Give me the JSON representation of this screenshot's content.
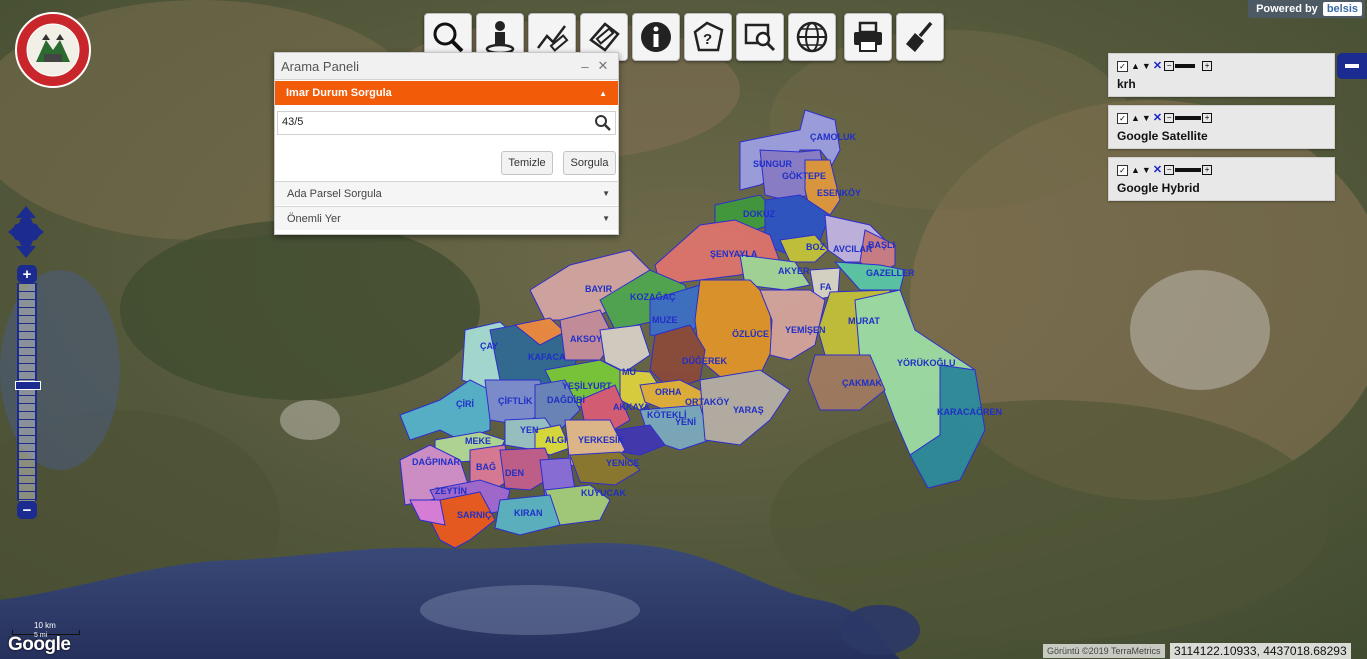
{
  "toolbar": {
    "tools": [
      {
        "name": "search-tool-button",
        "icon": "magnifier-icon"
      },
      {
        "name": "person-tool-button",
        "icon": "person-icon"
      },
      {
        "name": "measure-distance-button",
        "icon": "ruler-line-icon"
      },
      {
        "name": "measure-area-button",
        "icon": "area-ruler-icon"
      },
      {
        "name": "info-button",
        "icon": "info-icon"
      },
      {
        "name": "identify-area-button",
        "icon": "polygon-question-icon"
      },
      {
        "name": "zoom-box-button",
        "icon": "zoom-rectangle-icon"
      },
      {
        "name": "globe-button",
        "icon": "globe-icon"
      },
      {
        "name": "print-button",
        "icon": "printer-icon"
      },
      {
        "name": "clear-button",
        "icon": "broom-icon"
      }
    ]
  },
  "powered": {
    "label": "Powered by",
    "brand": "belsis"
  },
  "search_panel": {
    "title": "Arama Paneli",
    "minimize": "‒",
    "close": "✕",
    "active_section": "Imar Durum Sorgula",
    "input_value": "43/5",
    "clear_button": "Temizle",
    "query_button": "Sorgula",
    "sections": [
      "Ada Parsel Sorgula",
      "Önemli Yer"
    ]
  },
  "layers": [
    {
      "name": "krh"
    },
    {
      "name": "Google Satellite"
    },
    {
      "name": "Google Hybrid"
    }
  ],
  "map": {
    "labels": [
      "ÇAMOLUK",
      "SUNGUR",
      "GÖKTEPE",
      "ESENKÖY",
      "DOKUZ",
      "BOZ",
      "AVCILAR",
      "BAŞLI",
      "ŞENYAYLA",
      "AKYER",
      "GAZELLER",
      "FA",
      "BAYIR",
      "KOZAĞAÇ",
      "MUZE",
      "ÖZLÜCE",
      "YEMİŞEN",
      "MURAT",
      "ÇAY",
      "KAFACA",
      "AKSOY",
      "DÜĞEREK",
      "YÖRÜKOĞLU",
      "YEŞİLYURT",
      "ORHA",
      "ÇAKMAK",
      "ÇİRİ",
      "ÇİFTLİK",
      "DAĞDİBİ",
      "AKKAYA",
      "ORTAKÖY",
      "YARAŞ",
      "KARACAÖREN",
      "KÖTEKLİ",
      "YENİ",
      "YEN",
      "MEKE",
      "ALGI",
      "YERKESİK",
      "BAĞ",
      "DEN",
      "YENİCE",
      "DAĞPINAR",
      "ZEYTİN",
      "KUYUCAK",
      "SARNIÇ",
      "KIRAN",
      "MU"
    ],
    "attribution": "Görüntü ©2019 TerraMetrics",
    "coordinates": "3114122.10933, 4437018.68293",
    "scale_km": "10 km",
    "scale_mi": "5 mi",
    "google_logo": "Google",
    "logo_text": "BELEDİYE BAŞKANLIĞI MENTEŞE"
  },
  "zoom": {
    "plus": "+",
    "minus": "−",
    "level": 0.45
  }
}
